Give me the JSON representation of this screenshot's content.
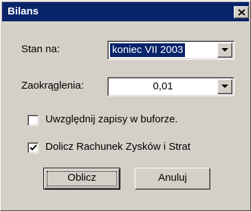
{
  "window": {
    "title": "Bilans",
    "close_icon": "close-icon"
  },
  "form": {
    "stan_na": {
      "label": "Stan na:",
      "value": "koniec VII 2003"
    },
    "zaokraglenia": {
      "label": "Zaokrąglenia:",
      "value": "0,01"
    },
    "uwzglednij": {
      "label": "Uwzględnij zapisy w buforze.",
      "checked": false
    },
    "dolicz": {
      "label": "Dolicz Rachunek Zysków i Strat",
      "checked": true
    }
  },
  "buttons": {
    "oblicz_label": "Oblicz",
    "anuluj_label": "Anuluj"
  },
  "colors": {
    "titlebar": "#0a246a",
    "face": "#d4d0c8",
    "selection": "#0a246a"
  }
}
